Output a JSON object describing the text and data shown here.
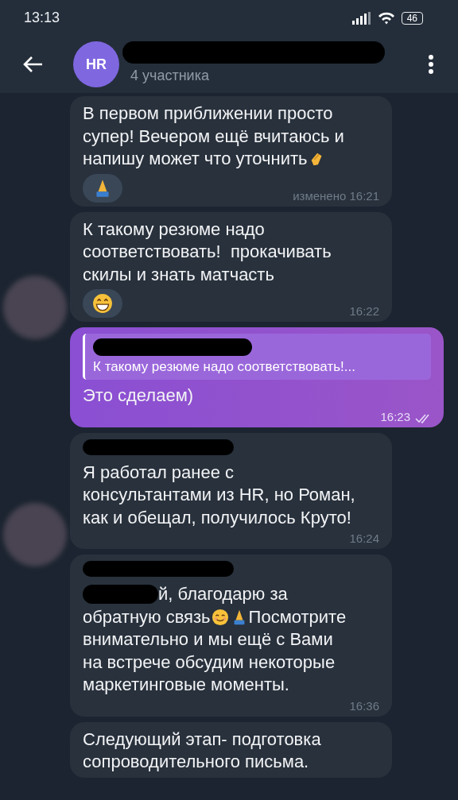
{
  "status_bar": {
    "time": "13:13",
    "battery": "46"
  },
  "header": {
    "avatar": "HR",
    "subtitle": "4 участника",
    "name_redacted": true
  },
  "messages": [
    {
      "kind": "in",
      "lines": [
        [
          {
            "kind": "text",
            "text": "В первом приближении просто"
          }
        ],
        [
          {
            "kind": "text",
            "text": "супер! Вечером ещё вчитаюсь и"
          }
        ],
        [
          {
            "kind": "text",
            "text": "напишу может что уточнить"
          },
          {
            "kind": "clap"
          }
        ]
      ],
      "reaction": {
        "kind": "pray"
      },
      "time": "изменено 16:21"
    },
    {
      "kind": "in",
      "lines": [
        [
          {
            "kind": "text",
            "text": "К такому резюме надо"
          }
        ],
        [
          {
            "kind": "text",
            "text": "соответствовать!  прокачивать"
          }
        ],
        [
          {
            "kind": "text",
            "text": "скилы и знать матчасть"
          }
        ]
      ],
      "reaction": {
        "kind": "grin"
      },
      "time": "16:22",
      "blurred_avatar": true
    },
    {
      "kind": "out",
      "quote": {
        "text": "К такому резюме надо соответствовать!...",
        "sender_redacted": true
      },
      "lines": [
        [
          {
            "kind": "text",
            "text": "Это сделаем)"
          }
        ]
      ],
      "time": "16:23",
      "read": true
    },
    {
      "kind": "in",
      "sender_redacted": true,
      "lines": [
        [
          {
            "kind": "text",
            "text": "Я работал ранее с"
          }
        ],
        [
          {
            "kind": "text",
            "text": "консультантами из HR, но Роман,"
          }
        ],
        [
          {
            "kind": "text",
            "text": "как и обещал, получилось Круто!"
          }
        ]
      ],
      "time": "16:24",
      "blurred_avatar": true
    },
    {
      "kind": "in",
      "sender_redacted": true,
      "lines": [
        [
          {
            "kind": "redacted"
          },
          {
            "kind": "text",
            "text": "й, благодарю за"
          }
        ],
        [
          {
            "kind": "text",
            "text": "обратную связь"
          },
          {
            "kind": "smile"
          },
          {
            "kind": "pray"
          },
          {
            "kind": "text",
            "text": "Посмотрите"
          }
        ],
        [
          {
            "kind": "text",
            "text": "внимательно и мы ещё с Вами"
          }
        ],
        [
          {
            "kind": "text",
            "text": "на встрече обсудим некоторые"
          }
        ],
        [
          {
            "kind": "text",
            "text": "маркетинговые моменты."
          }
        ]
      ],
      "time": "16:36"
    },
    {
      "kind": "in",
      "lines": [
        [
          {
            "kind": "text",
            "text": "Следующий этап- подготовка"
          }
        ],
        [
          {
            "kind": "text",
            "text": "сопроводительного письма."
          }
        ]
      ]
    }
  ]
}
